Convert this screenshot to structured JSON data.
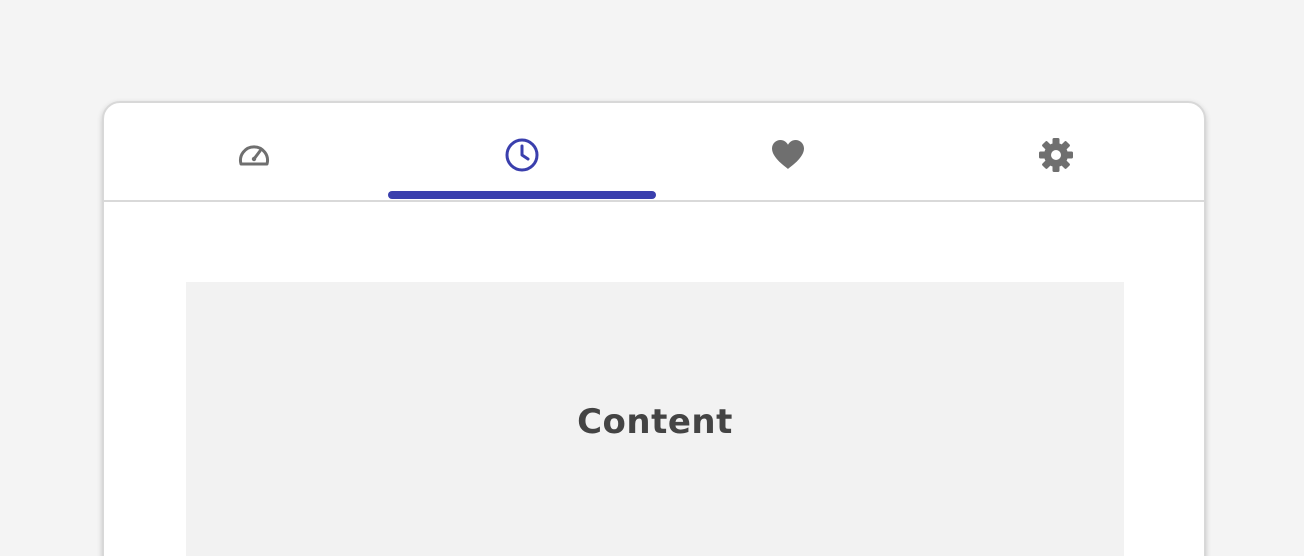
{
  "tabs": [
    {
      "id": "dashboard",
      "icon": "speedometer-icon",
      "active": false
    },
    {
      "id": "history",
      "icon": "clock-icon",
      "active": true
    },
    {
      "id": "favorites",
      "icon": "heart-icon",
      "active": false
    },
    {
      "id": "settings",
      "icon": "gear-icon",
      "active": false
    }
  ],
  "content": {
    "label": "Content"
  },
  "colors": {
    "accent": "#3a3fad",
    "icon_inactive": "#6f6f6f",
    "content_text": "#444444"
  }
}
